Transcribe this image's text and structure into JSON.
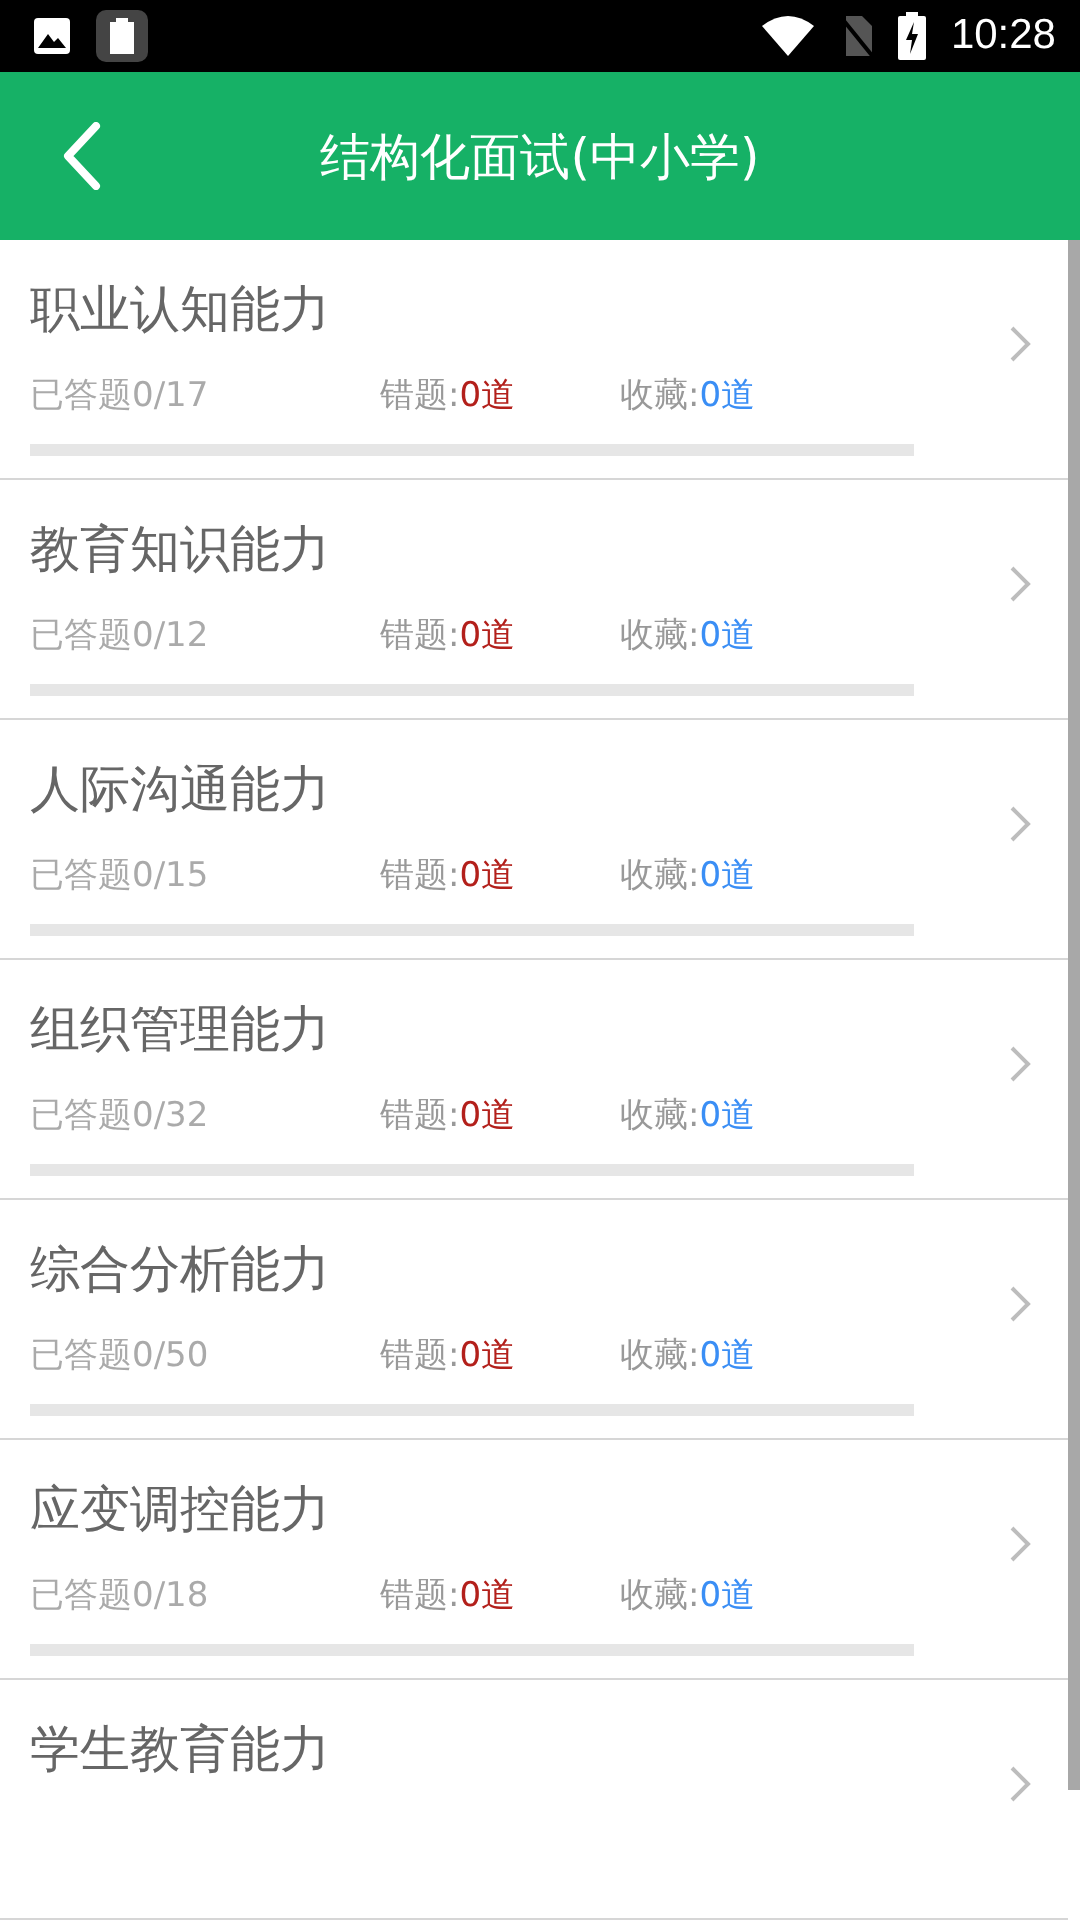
{
  "status_bar": {
    "time": "10:28"
  },
  "toolbar": {
    "title": "结构化面试(中小学)"
  },
  "categories": [
    {
      "title": "职业认知能力",
      "answered": "已答题0/17",
      "wrong_label": "错题:",
      "wrong_count": "0道",
      "fav_label": "收藏:",
      "fav_count": "0道",
      "level": 0
    },
    {
      "title": "教育知识能力",
      "answered": "已答题0/12",
      "wrong_label": "错题:",
      "wrong_count": "0道",
      "fav_label": "收藏:",
      "fav_count": "0道",
      "level": 0
    },
    {
      "title": "人际沟通能力",
      "answered": "已答题0/15",
      "wrong_label": "错题:",
      "wrong_count": "0道",
      "fav_label": "收藏:",
      "fav_count": "0道",
      "level": 0
    },
    {
      "title": "组织管理能力",
      "answered": "已答题0/32",
      "wrong_label": "错题:",
      "wrong_count": "0道",
      "fav_label": "收藏:",
      "fav_count": "0道",
      "level": 0
    },
    {
      "title": "综合分析能力",
      "answered": "已答题0/50",
      "wrong_label": "错题:",
      "wrong_count": "0道",
      "fav_label": "收藏:",
      "fav_count": "0道",
      "level": 0
    },
    {
      "title": "应变调控能力",
      "answered": "已答题0/18",
      "wrong_label": "错题:",
      "wrong_count": "0道",
      "fav_label": "收藏:",
      "fav_count": "0道",
      "level": 0
    },
    {
      "title": "学生教育能力"
    }
  ]
}
